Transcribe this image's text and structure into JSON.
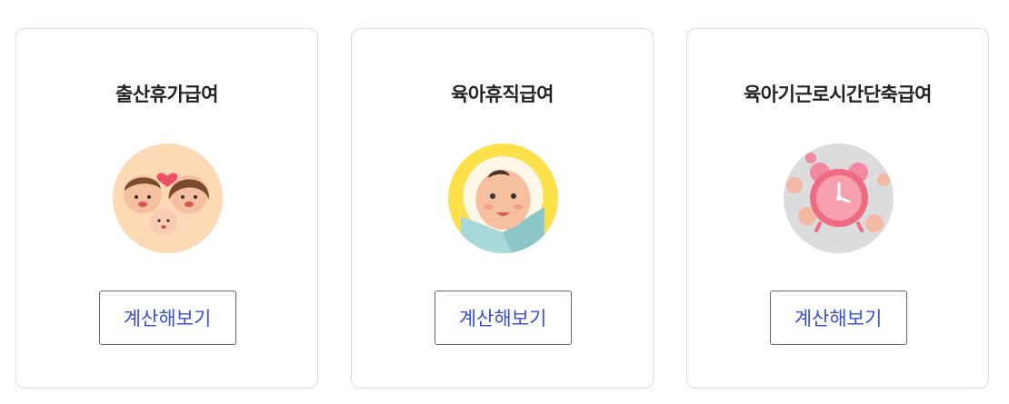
{
  "cards": [
    {
      "title": "출산휴가급여",
      "button_label": "계산해보기",
      "icon": "family-icon",
      "bg_color": "#fdd9b5"
    },
    {
      "title": "육아휴직급여",
      "button_label": "계산해보기",
      "icon": "baby-icon",
      "bg_color": "#fce14b"
    },
    {
      "title": "육아기근로시간단축급여",
      "button_label": "계산해보기",
      "icon": "alarm-clock-icon",
      "bg_color": "#dcdcdc"
    }
  ],
  "colors": {
    "button_text": "#3a4fd8",
    "title_text": "#222222",
    "card_border": "#dcdcdc"
  }
}
